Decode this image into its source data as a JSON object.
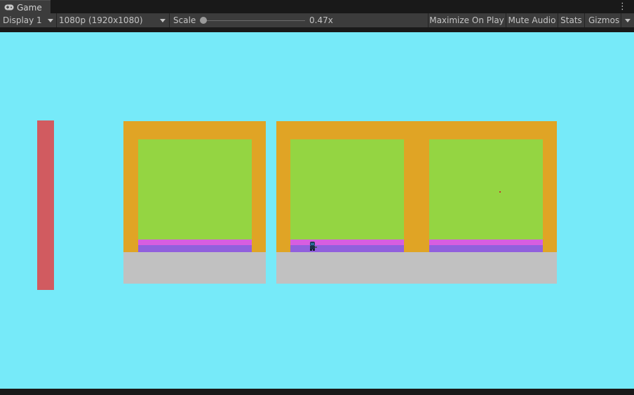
{
  "tab": {
    "label": "Game",
    "icon": "gamepad-icon"
  },
  "toolbar": {
    "display": "Display 1",
    "resolution": "1080p (1920x1080)",
    "scale_label": "Scale",
    "scale_value": "0.47x",
    "scale_fraction": 0.0,
    "maximize": "Maximize On Play",
    "mute": "Mute Audio",
    "stats": "Stats",
    "gizmos": "Gizmos"
  },
  "scene": {
    "sky_color": "#76eaf9",
    "wall_color": "#e0a425",
    "room_color": "#94d542",
    "floor_pink": "#d75ee0",
    "floor_purple": "#9160dd",
    "ground_color": "#c1c1c1",
    "pillar_color": "#d15b60"
  }
}
